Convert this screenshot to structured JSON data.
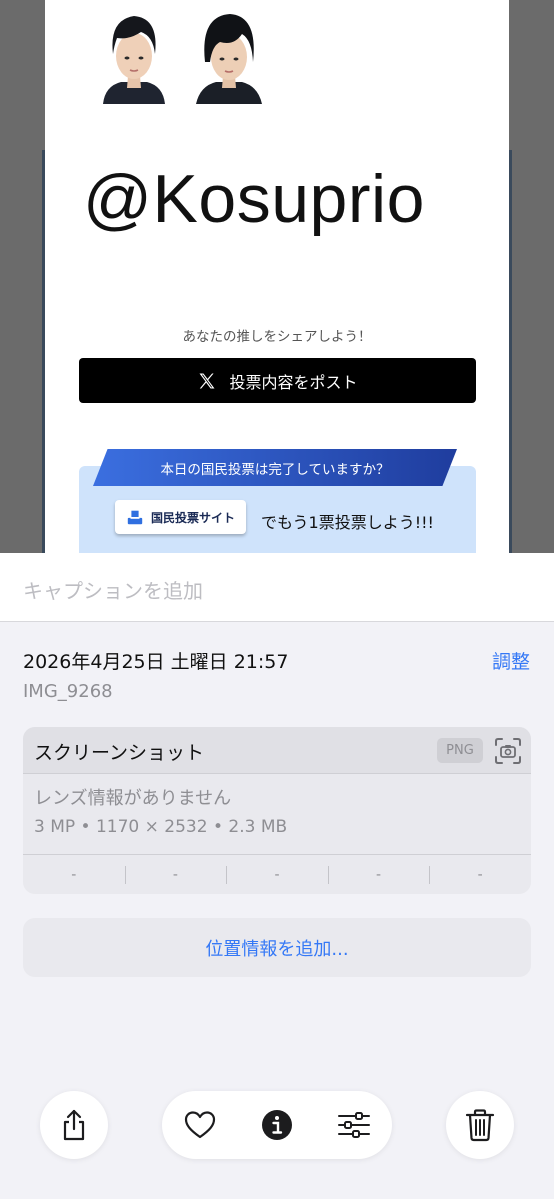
{
  "preview": {
    "handle": "@Kosuprio",
    "share_prompt": "あなたの推しをシェアしよう！",
    "post_button_label": "投票内容をポスト",
    "vote_banner": "本日の国民投票は完了していますか？",
    "site_button_label": "国民投票サイト",
    "vote_cta": "でもう1票投票しよう!!!"
  },
  "caption": {
    "placeholder": "キャプションを追加"
  },
  "info": {
    "datetime": "2026年4月25日 土曜日 21:57",
    "adjust_label": "調整",
    "filename": "IMG_9268"
  },
  "metadata": {
    "title": "スクリーンショット",
    "format_badge": "PNG",
    "lens_info": "レンズ情報がありません",
    "specs": "3 MP • 1170 × 2532 • 2.3 MB",
    "exif": [
      "-",
      "-",
      "-",
      "-",
      "-"
    ]
  },
  "location": {
    "add_label": "位置情報を追加..."
  },
  "toolbar": {
    "icons": [
      "share-icon",
      "heart-icon",
      "info-icon",
      "adjust-icon",
      "trash-icon"
    ]
  },
  "colors": {
    "accent": "#3478f6",
    "vote_box": "#cfe3fb",
    "ribbon_start": "#3b6fe0",
    "ribbon_end": "#1f3d9e"
  }
}
